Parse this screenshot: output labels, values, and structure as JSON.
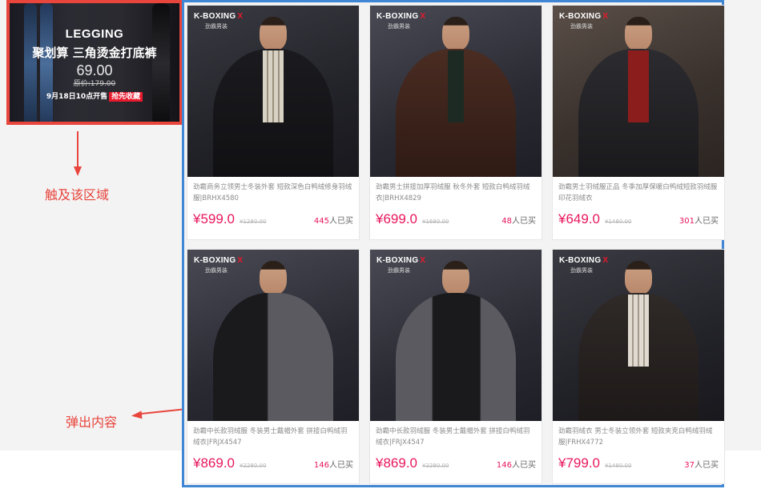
{
  "banner": {
    "title": "LEGGING",
    "subtitle": "聚划算 三角烫金打底裤",
    "price": "69.00",
    "original": "原价:179.00",
    "date_text": "9月18日10点开售",
    "tag": "抢先收藏"
  },
  "annotations": {
    "trigger_label": "触及该区域",
    "popup_label": "弹出内容"
  },
  "colors": {
    "annotation_red": "#e8453c",
    "popup_border_blue": "#3f86d4",
    "price_pink": "#e8175d"
  },
  "product_brand": {
    "logo_text": "K-BOXING",
    "logo_mark": "X",
    "logo_subtext": "劲霸男装"
  },
  "products": [
    {
      "title": "劲霸商务立领男士冬装外套 短款深色白鸭绒修身羽绒服|BRHX4580",
      "price": "¥599.0",
      "original": "¥1280.00",
      "sold_count": "445",
      "sold_unit": "人已买"
    },
    {
      "title": "劲霸男士拼接加厚羽绒服 秋冬外套 短款白鸭绒羽绒衣|BRHX4829",
      "price": "¥699.0",
      "original": "¥1680.00",
      "sold_count": "48",
      "sold_unit": "人已买"
    },
    {
      "title": "劲霸男士羽绒服正品 冬季加厚保暖白鸭绒短款羽绒服印花羽绒衣",
      "price": "¥649.0",
      "original": "¥1480.00",
      "sold_count": "301",
      "sold_unit": "人已买"
    },
    {
      "title": "劲霸中长款羽绒服 冬装男士戴帽外套 拼接白鸭绒羽绒衣|FRJX4547",
      "price": "¥869.0",
      "original": "¥2280.00",
      "sold_count": "146",
      "sold_unit": "人已买"
    },
    {
      "title": "劲霸中长款羽绒服 冬装男士戴帽外套 拼接白鸭绒羽绒衣|FRJX4547",
      "price": "¥869.0",
      "original": "¥2280.00",
      "sold_count": "146",
      "sold_unit": "人已买"
    },
    {
      "title": "劲霸羽绒衣 男士冬装立领外套 短款夹克白鸭绒羽绒服|FRHX4772",
      "price": "¥799.0",
      "original": "¥1480.00",
      "sold_count": "37",
      "sold_unit": "人已买"
    }
  ]
}
